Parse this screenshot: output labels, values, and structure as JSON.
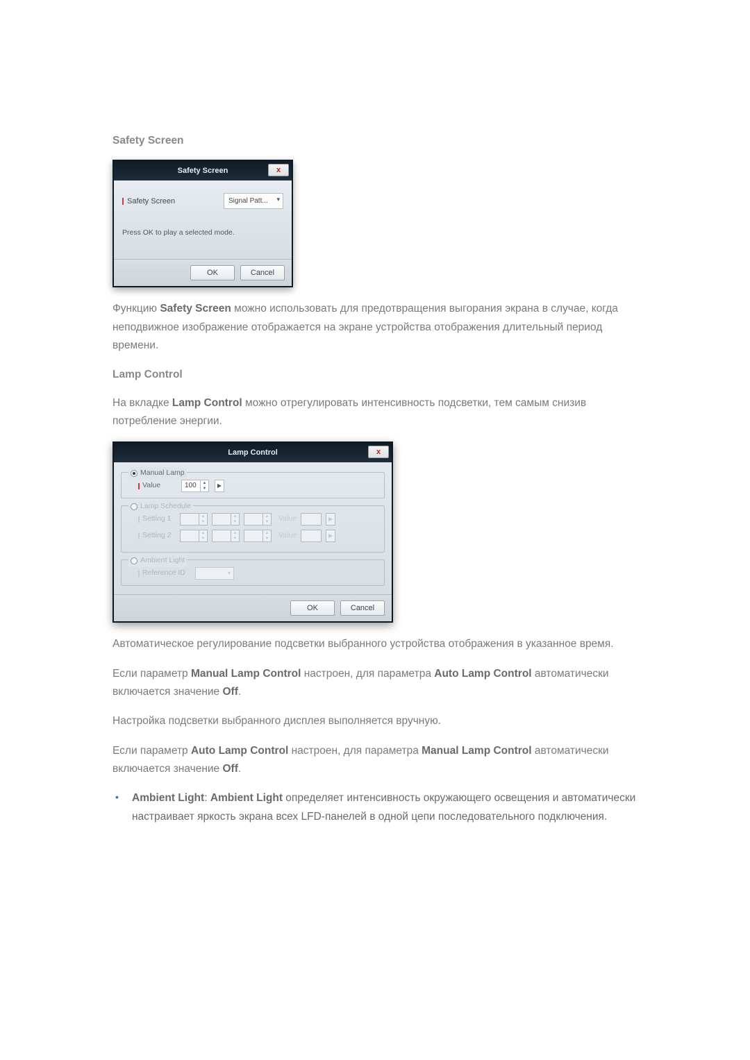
{
  "headings": {
    "safety_screen": "Safety Screen",
    "lamp_control": "Lamp Control"
  },
  "safety_dialog": {
    "title": "Safety Screen",
    "close": "x",
    "field_label": "Safety Screen",
    "dropdown_value": "Signal Patt...",
    "message": "Press OK to play a selected mode.",
    "ok": "OK",
    "cancel": "Cancel"
  },
  "safety_para_prefix": "Функцию ",
  "safety_para_bold": "Safety Screen",
  "safety_para_suffix": " можно использовать для предотвращения выгорания экрана в случае, когда неподвижное изображение отображается на экране устройства отображения длительный период времени.",
  "lamp_desc_prefix": "На вкладке ",
  "lamp_desc_bold": "Lamp Control",
  "lamp_desc_suffix": " можно отрегулировать интенсивность подсветки, тем самым снизив потребление энергии.",
  "lamp_dialog": {
    "title": "Lamp Control",
    "close": "x",
    "manual": {
      "legend": "Manual Lamp",
      "value_label": "Value",
      "value": "100"
    },
    "schedule": {
      "legend": "Lamp Schedule",
      "row1_label": "Setting 1",
      "row2_label": "Setting 2",
      "value_label": "Value"
    },
    "ambient": {
      "legend": "Ambient Light",
      "ref_label": "Reference ID"
    },
    "ok": "OK",
    "cancel": "Cancel"
  },
  "paras": {
    "auto_desc": "Автоматическое регулирование подсветки выбранного устройства отображения в указанное время.",
    "manual_prefix": "Если параметр ",
    "manual_b1": "Manual Lamp Control",
    "manual_mid": " настроен, для параметра ",
    "manual_b2": "Auto Lamp Control",
    "manual_suffix": " автоматически включается значение ",
    "off": "Off",
    "manual_adjust": "Настройка подсветки выбранного дисплея выполняется вручную.",
    "auto_prefix": "Если параметр ",
    "auto_b1": "Auto Lamp Control",
    "auto_mid": " настроен, для параметра ",
    "auto_b2": "Manual Lamp Control",
    "auto_suffix": " автоматически включается значение ",
    "bullet_b1": "Ambient Light",
    "bullet_sep": ": ",
    "bullet_b2": "Ambient Light",
    "bullet_rest": " определяет интенсивность окружающего освещения и автоматически настраивает яркость экрана всех LFD-панелей в одной цепи последовательного подключения."
  }
}
